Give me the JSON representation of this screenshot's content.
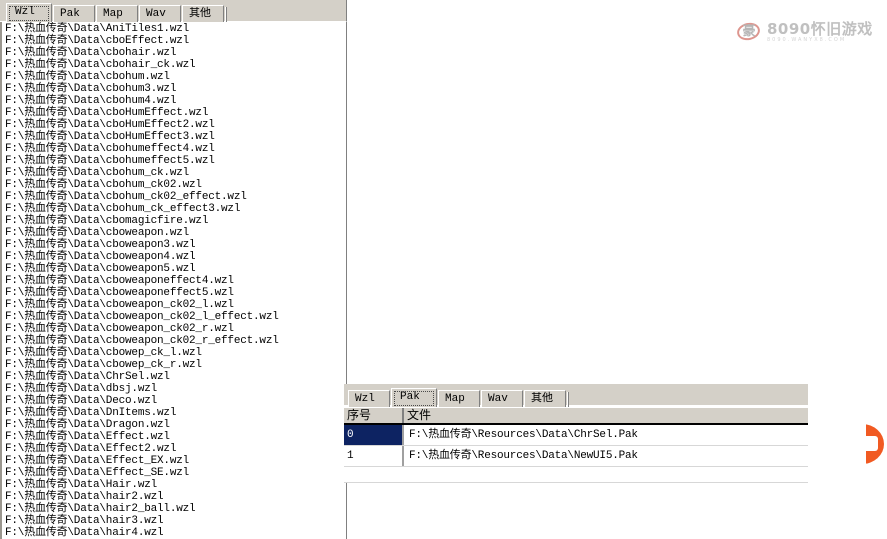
{
  "windows": {
    "wzl": {
      "tabs": [
        {
          "label": "Wzl",
          "selected": true
        },
        {
          "label": "Pak",
          "selected": false
        },
        {
          "label": "Map",
          "selected": false
        },
        {
          "label": "Wav",
          "selected": false
        },
        {
          "label": "其他",
          "selected": false
        }
      ],
      "rows": [
        "F:\\热血传奇\\Data\\AniTiles1.wzl",
        "F:\\热血传奇\\Data\\cboEffect.wzl",
        "F:\\热血传奇\\Data\\cbohair.wzl",
        "F:\\热血传奇\\Data\\cbohair_ck.wzl",
        "F:\\热血传奇\\Data\\cbohum.wzl",
        "F:\\热血传奇\\Data\\cbohum3.wzl",
        "F:\\热血传奇\\Data\\cbohum4.wzl",
        "F:\\热血传奇\\Data\\cboHumEffect.wzl",
        "F:\\热血传奇\\Data\\cboHumEffect2.wzl",
        "F:\\热血传奇\\Data\\cboHumEffect3.wzl",
        "F:\\热血传奇\\Data\\cbohumeffect4.wzl",
        "F:\\热血传奇\\Data\\cbohumeffect5.wzl",
        "F:\\热血传奇\\Data\\cbohum_ck.wzl",
        "F:\\热血传奇\\Data\\cbohum_ck02.wzl",
        "F:\\热血传奇\\Data\\cbohum_ck02_effect.wzl",
        "F:\\热血传奇\\Data\\cbohum_ck_effect3.wzl",
        "F:\\热血传奇\\Data\\cbomagicfire.wzl",
        "F:\\热血传奇\\Data\\cboweapon.wzl",
        "F:\\热血传奇\\Data\\cboweapon3.wzl",
        "F:\\热血传奇\\Data\\cboweapon4.wzl",
        "F:\\热血传奇\\Data\\cboweapon5.wzl",
        "F:\\热血传奇\\Data\\cboweaponeffect4.wzl",
        "F:\\热血传奇\\Data\\cboweaponeffect5.wzl",
        "F:\\热血传奇\\Data\\cboweapon_ck02_l.wzl",
        "F:\\热血传奇\\Data\\cboweapon_ck02_l_effect.wzl",
        "F:\\热血传奇\\Data\\cboweapon_ck02_r.wzl",
        "F:\\热血传奇\\Data\\cboweapon_ck02_r_effect.wzl",
        "F:\\热血传奇\\Data\\cbowep_ck_l.wzl",
        "F:\\热血传奇\\Data\\cbowep_ck_r.wzl",
        "F:\\热血传奇\\Data\\ChrSel.wzl",
        "F:\\热血传奇\\Data\\dbsj.wzl",
        "F:\\热血传奇\\Data\\Deco.wzl",
        "F:\\热血传奇\\Data\\DnItems.wzl",
        "F:\\热血传奇\\Data\\Dragon.wzl",
        "F:\\热血传奇\\Data\\Effect.wzl",
        "F:\\热血传奇\\Data\\Effect2.wzl",
        "F:\\热血传奇\\Data\\Effect_EX.wzl",
        "F:\\热血传奇\\Data\\Effect_SE.wzl",
        "F:\\热血传奇\\Data\\Hair.wzl",
        "F:\\热血传奇\\Data\\hair2.wzl",
        "F:\\热血传奇\\Data\\hair2_ball.wzl",
        "F:\\热血传奇\\Data\\hair3.wzl",
        "F:\\热血传奇\\Data\\hair4.wzl"
      ]
    },
    "pak": {
      "tabs": [
        {
          "label": "Wzl",
          "selected": false
        },
        {
          "label": "Pak",
          "selected": true
        },
        {
          "label": "Map",
          "selected": false
        },
        {
          "label": "Wav",
          "selected": false
        },
        {
          "label": "其他",
          "selected": false
        }
      ],
      "columns": [
        {
          "label": "序号"
        },
        {
          "label": "文件"
        }
      ],
      "rows": [
        {
          "index": "0",
          "file": "F:\\热血传奇\\Resources\\Data\\ChrSel.Pak",
          "selected": true
        },
        {
          "index": "1",
          "file": "F:\\热血传奇\\Resources\\Data\\NewUI5.Pak",
          "selected": false
        }
      ]
    }
  },
  "watermark": {
    "title": "8090怀旧游戏",
    "url": "8090.WANYX8.COM",
    "mark": "8090-logo-icon"
  },
  "edge_badge": {
    "name": "orange-edge-badge",
    "color": "#f15a22"
  },
  "colors": {
    "tab_face": "#d4d0c8",
    "selection": "#0d2362",
    "selection_text": "#ffffff",
    "list_background": "#ffffff",
    "header_rule": "#000000"
  }
}
